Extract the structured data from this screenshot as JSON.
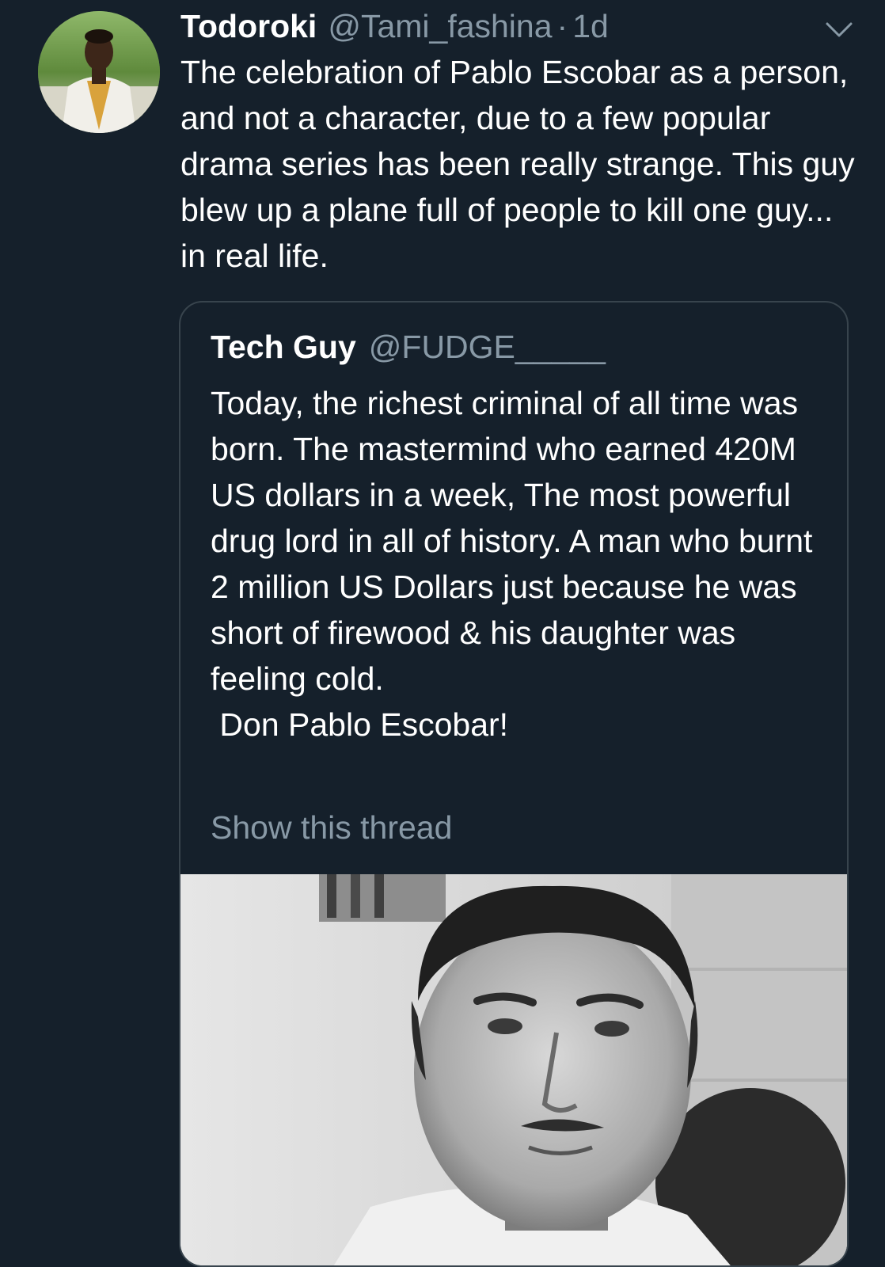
{
  "tweet": {
    "display_name": "Todoroki",
    "handle": "@Tami_fashina",
    "separator": "·",
    "timestamp": "1d",
    "avatar_icon": "user-avatar-photo",
    "menu_icon": "chevron-down-icon",
    "text": "The celebration of Pablo Escobar as a person, and not a character, due to a few popular drama series has been really strange. This guy blew up a plane full of people to kill one guy... in real life."
  },
  "quoted_tweet": {
    "display_name": "Tech Guy",
    "handle": "@FUDGE_____",
    "text": "Today, the richest criminal of all time was born. The mastermind who earned 420M US dollars in a week, The most powerful drug lord in all of history. A man who burnt 2 million US Dollars just because he was short of firewood & his daughter was feeling cold.\n Don Pablo Escobar!",
    "show_thread_label": "Show this thread",
    "image": "black-and-white-portrait-photo"
  },
  "colors": {
    "background": "#15202b",
    "text_primary": "#ffffff",
    "text_secondary": "#8899a6",
    "card_border": "#38444d"
  }
}
